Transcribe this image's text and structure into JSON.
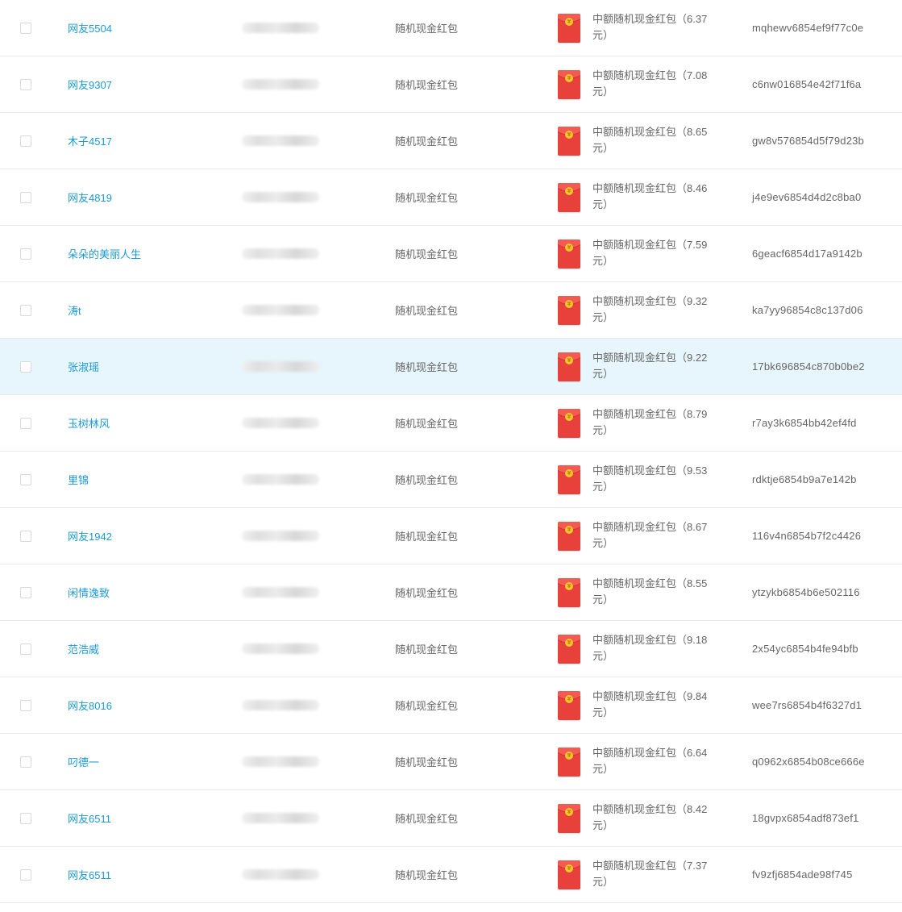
{
  "table": {
    "type_label": "随机现金红包",
    "rows": [
      {
        "name": "网友5504",
        "type": "随机现金红包",
        "prize": "中额随机现金红包（6.37元）",
        "code": "mqhewv6854ef9f77c0e",
        "selected": false,
        "highlight": false
      },
      {
        "name": "网友9307",
        "type": "随机现金红包",
        "prize": "中额随机现金红包（7.08元）",
        "code": "c6nw016854e42f71f6a",
        "selected": false,
        "highlight": false
      },
      {
        "name": "木子4517",
        "type": "随机现金红包",
        "prize": "中额随机现金红包（8.65元）",
        "code": "gw8v576854d5f79d23b",
        "selected": false,
        "highlight": false
      },
      {
        "name": "网友4819",
        "type": "随机现金红包",
        "prize": "中额随机现金红包（8.46元）",
        "code": "j4e9ev6854d4d2c8ba0",
        "selected": false,
        "highlight": false
      },
      {
        "name": "朵朵的美丽人生",
        "type": "随机现金红包",
        "prize": "中额随机现金红包（7.59元）",
        "code": "6geacf6854d17a9142b",
        "selected": false,
        "highlight": false
      },
      {
        "name": "涛t",
        "type": "随机现金红包",
        "prize": "中额随机现金红包（9.32元）",
        "code": "ka7yy96854c8c137d06",
        "selected": false,
        "highlight": false
      },
      {
        "name": "张淑瑶",
        "type": "随机现金红包",
        "prize": "中额随机现金红包（9.22元）",
        "code": "17bk696854c870b0be2",
        "selected": false,
        "highlight": true
      },
      {
        "name": "玉树林风",
        "type": "随机现金红包",
        "prize": "中额随机现金红包（8.79元）",
        "code": "r7ay3k6854bb42ef4fd",
        "selected": false,
        "highlight": false
      },
      {
        "name": "里锦",
        "type": "随机现金红包",
        "prize": "中额随机现金红包（9.53元）",
        "code": "rdktje6854b9a7e142b",
        "selected": false,
        "highlight": false
      },
      {
        "name": "网友1942",
        "type": "随机现金红包",
        "prize": "中额随机现金红包（8.67元）",
        "code": "116v4n6854b7f2c4426",
        "selected": false,
        "highlight": false
      },
      {
        "name": "闲情逸致",
        "type": "随机现金红包",
        "prize": "中额随机现金红包（8.55元）",
        "code": "ytzykb6854b6e502116",
        "selected": false,
        "highlight": false
      },
      {
        "name": "范浩威",
        "type": "随机现金红包",
        "prize": "中额随机现金红包（9.18元）",
        "code": "2x54yc6854b4fe94bfb",
        "selected": false,
        "highlight": false
      },
      {
        "name": "网友8016",
        "type": "随机现金红包",
        "prize": "中额随机现金红包（9.84元）",
        "code": "wee7rs6854b4f6327d1",
        "selected": false,
        "highlight": false
      },
      {
        "name": "叼德一",
        "type": "随机现金红包",
        "prize": "中额随机现金红包（6.64元）",
        "code": "q0962x6854b08ce666e",
        "selected": false,
        "highlight": false
      },
      {
        "name": "网友6511",
        "type": "随机现金红包",
        "prize": "中额随机现金红包（8.42元）",
        "code": "18gvpx6854adf873ef1",
        "selected": false,
        "highlight": false
      },
      {
        "name": "网友6511",
        "type": "随机现金红包",
        "prize": "中额随机现金红包（7.37元）",
        "code": "fv9zfj6854ade98f745",
        "selected": false,
        "highlight": false
      }
    ]
  },
  "colors": {
    "link": "#1c9ad6",
    "text": "#666666",
    "row_border": "#e9e9e9",
    "row_highlight": "#e7f5fc",
    "envelope_red": "#e8413c",
    "coin_gold": "#f7c52e"
  },
  "icons": {
    "envelope": "red-envelope-icon",
    "coin": "coin-icon"
  }
}
